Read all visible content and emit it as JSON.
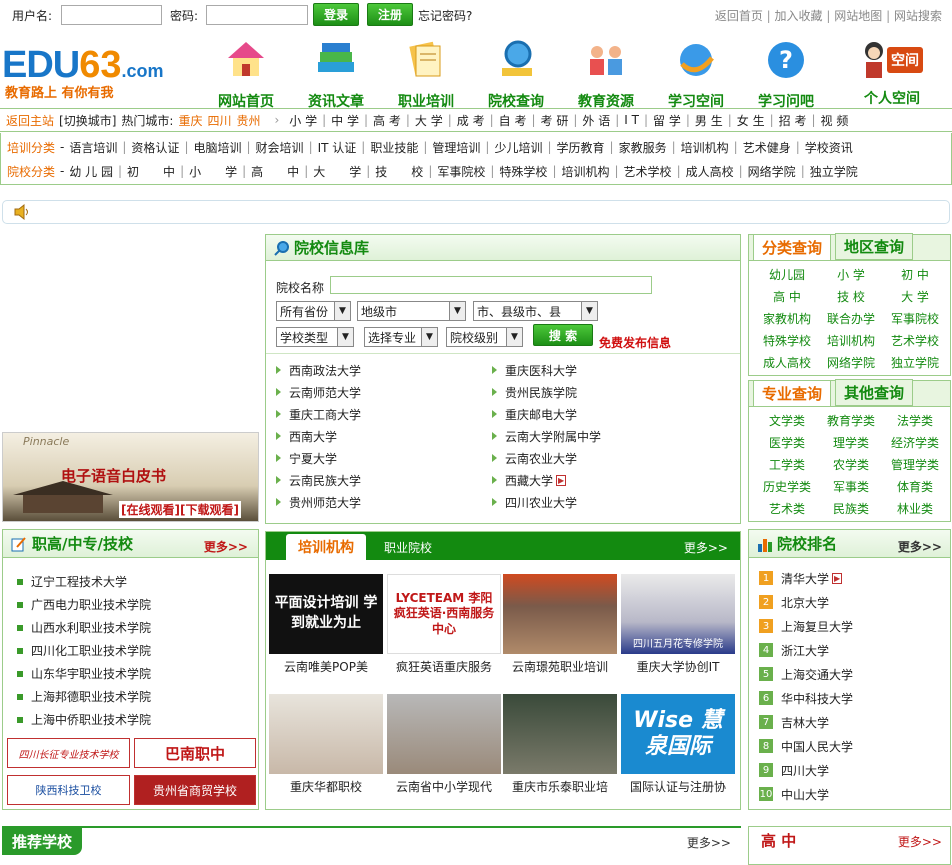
{
  "top": {
    "username_label": "用户名:",
    "password_label": "密码:",
    "login": "登录",
    "register": "注册",
    "forgot": "忘记密码?",
    "links": [
      "返回首页",
      "加入收藏",
      "网站地图",
      "网站搜索"
    ]
  },
  "logo": {
    "text_a": "EDU",
    "text_b": "63",
    "text_c": ".com",
    "slogan": "教育路上 有你有我"
  },
  "nav": [
    "网站首页",
    "资讯文章",
    "职业培训",
    "院校查询",
    "教育资源",
    "学习空间",
    "学习问吧",
    "个人空间"
  ],
  "space_badge": "空间",
  "city": {
    "back": "返回主站",
    "switch": "[切换城市]",
    "hot_label": "热门城市:",
    "cities": [
      "重庆",
      "四川",
      "贵州"
    ],
    "links": [
      "小 学",
      "中 学",
      "高 考",
      "大 学",
      "成 考",
      "自 考",
      "考 研",
      "外 语",
      "I T",
      "留 学",
      "男 生",
      "女 生",
      "招 考",
      "视 频"
    ]
  },
  "cats": {
    "train_label": "培训分类",
    "train": [
      "语言培训",
      "资格认证",
      "电脑培训",
      "财会培训",
      "IT 认证",
      "职业技能",
      "管理培训",
      "少儿培训",
      "学历教育",
      "家教服务",
      "培训机构",
      "艺术健身",
      "学校资讯"
    ],
    "school_label": "院校分类",
    "school": [
      "幼 儿 园",
      "初　　中",
      "小　　学",
      "高　　中",
      "大　　学",
      "技　　校",
      "军事院校",
      "特殊学校",
      "培训机构",
      "艺术学校",
      "成人高校",
      "网络学院",
      "独立学院"
    ]
  },
  "banner": {
    "title": "电子语音白皮书",
    "online": "[在线观看]",
    "download": "[下载观看]",
    "brand": "Pinnacle"
  },
  "schooldb": {
    "title": "院校信息库",
    "name_label": "院校名称",
    "sel": [
      "所有省份",
      "地级市",
      "市、县级市、县",
      "学校类型",
      "选择专业",
      "院校级别"
    ],
    "search": "搜 索",
    "publish": "免费发布信息",
    "left": [
      "西南政法大学",
      "云南师范大学",
      "重庆工商大学",
      "西南大学",
      "宁夏大学",
      "云南民族大学",
      "贵州师范大学"
    ],
    "right": [
      "重庆医科大学",
      "贵州民族学院",
      "重庆邮电大学",
      "云南大学附属中学",
      "云南农业大学",
      "西藏大学",
      "四川农业大学"
    ]
  },
  "cls": {
    "tab1": "分类查询",
    "tab2": "地区查询",
    "items": [
      "幼儿园",
      "小 学",
      "初 中",
      "高 中",
      "技 校",
      "大 学",
      "家教机构",
      "联合办学",
      "军事院校",
      "特殊学校",
      "培训机构",
      "艺术学校",
      "成人高校",
      "网络学院",
      "独立学院"
    ]
  },
  "major": {
    "tab1": "专业查询",
    "tab2": "其他查询",
    "items": [
      "文学类",
      "教育学类",
      "法学类",
      "医学类",
      "理学类",
      "经济学类",
      "工学类",
      "农学类",
      "管理学类",
      "历史学类",
      "军事类",
      "体育类",
      "艺术类",
      "民族类",
      "林业类"
    ]
  },
  "voc": {
    "title": "职高/中专/技校",
    "more": "更多>>",
    "items": [
      "辽宁工程技术大学",
      "广西电力职业技术学院",
      "山西水利职业技术学院",
      "四川化工职业技术学院",
      "山东华宇职业技术学院",
      "上海邦德职业技术学院",
      "上海中侨职业技术学院"
    ],
    "logos": [
      "四川长征专业技术学校",
      "巴南职中",
      "陕西科技卫校",
      "贵州省商贸学校"
    ]
  },
  "train": {
    "tab1": "培训机构",
    "tab2": "职业院校",
    "more": "更多>>",
    "items": [
      "云南唯美POP美",
      "疯狂英语重庆服务",
      "云南璟苑职业培训",
      "重庆大学协创IT",
      "重庆华都职校",
      "云南省中小学现代",
      "重庆市乐泰职业培",
      "国际认证与注册协"
    ],
    "img_text": [
      "平面设计培训 学到就业为止",
      "LYCETEAM 李阳疯狂英语·西南服务中心",
      "",
      "四川五月花专修学院",
      "",
      "",
      "",
      "Wise 慧泉国际"
    ]
  },
  "rank": {
    "title": "院校排名",
    "more": "更多>>",
    "items": [
      "清华大学",
      "北京大学",
      "上海复旦大学",
      "浙江大学",
      "上海交通大学",
      "华中科技大学",
      "吉林大学",
      "中国人民大学",
      "四川大学",
      "中山大学"
    ]
  },
  "rec": {
    "title": "推荐学校",
    "more": "更多>>"
  },
  "high": {
    "title": "高 中",
    "more": "更多>>"
  },
  "colors": {
    "green": "#138a10",
    "orange": "#e86b00",
    "border": "#9ccc8a"
  }
}
